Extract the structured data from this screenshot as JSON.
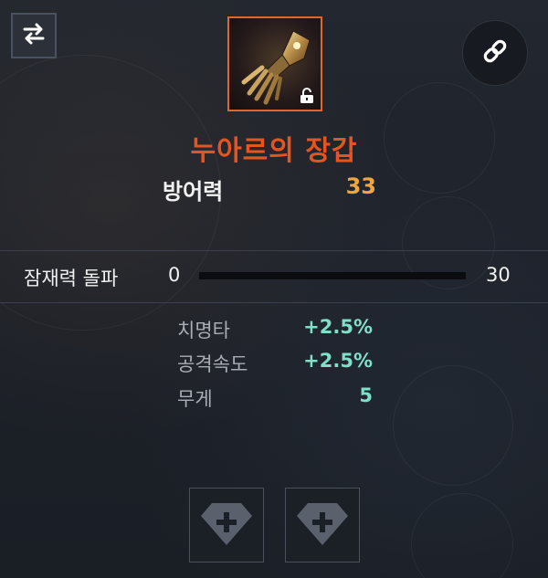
{
  "item": {
    "name": "누아르의 장갑",
    "icon": "gauntlet-icon",
    "lock_icon": "unlock-icon",
    "rarity_color": "#e0662a"
  },
  "main_stat": {
    "label": "방어력",
    "value": "33"
  },
  "potential": {
    "label": "잠재력 돌파",
    "min": "0",
    "max": "30",
    "current_fraction": 0
  },
  "sub_stats": [
    {
      "label": "치명타",
      "value": "+2.5%"
    },
    {
      "label": "공격속도",
      "value": "+2.5%"
    },
    {
      "label": "무게",
      "value": "5"
    }
  ],
  "gem_slots": [
    {
      "icon": "gem-add-icon"
    },
    {
      "icon": "gem-add-icon"
    }
  ],
  "toolbar": {
    "compare_icon": "swap-arrows-icon",
    "link_icon": "chain-link-icon"
  },
  "colors": {
    "name": "#e6541f",
    "main_value": "#f0a640",
    "sub_value": "#7fe0c8"
  }
}
